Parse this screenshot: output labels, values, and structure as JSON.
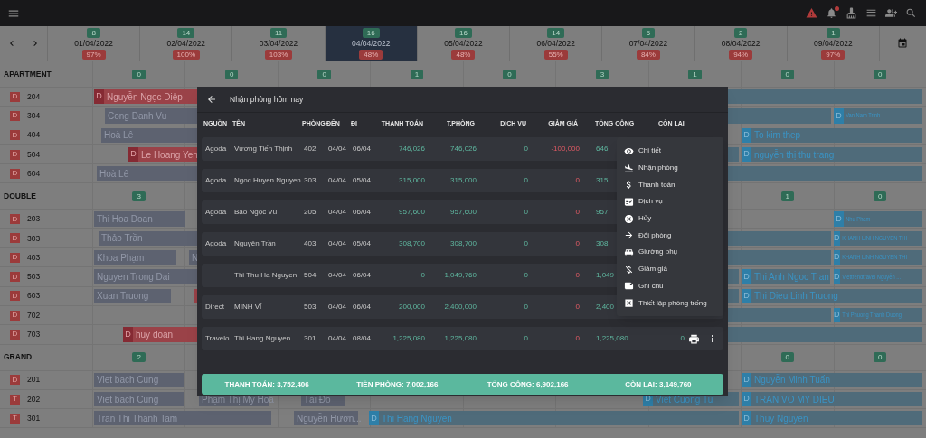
{
  "top_bar": {
    "notification_dot": true
  },
  "dates": [
    {
      "count": "8",
      "date": "01/04/2022",
      "occupancy": "97%",
      "selected": false
    },
    {
      "count": "14",
      "date": "02/04/2022",
      "occupancy": "100%",
      "selected": false
    },
    {
      "count": "11",
      "date": "03/04/2022",
      "occupancy": "103%",
      "selected": false
    },
    {
      "count": "16",
      "date": "04/04/2022",
      "occupancy": "48%",
      "selected": true
    },
    {
      "count": "16",
      "date": "05/04/2022",
      "occupancy": "48%",
      "selected": false
    },
    {
      "count": "14",
      "date": "06/04/2022",
      "occupancy": "55%",
      "selected": false
    },
    {
      "count": "5",
      "date": "07/04/2022",
      "occupancy": "84%",
      "selected": false
    },
    {
      "count": "2",
      "date": "08/04/2022",
      "occupancy": "94%",
      "selected": false
    },
    {
      "count": "1",
      "date": "09/04/2022",
      "occupancy": "97%",
      "selected": false
    }
  ],
  "groups": [
    {
      "name": "APARTMENT",
      "counts": [
        "0",
        "0",
        "0",
        "1",
        "0",
        "3",
        "1",
        "0",
        "0"
      ],
      "rooms": [
        {
          "type": "D",
          "number": "204",
          "bookings": [
            {
              "kind": "red",
              "flag": "D",
              "name": "Nguyễn Ngọc Diệp"
            },
            {
              "kind": "blue"
            }
          ]
        },
        {
          "type": "D",
          "number": "304",
          "bookings": [
            {
              "kind": "gray",
              "name": "Cong Danh Vu"
            },
            {
              "kind": "blue"
            },
            {
              "kind": "blue",
              "flag": "D",
              "name": "Van Nam Trinh"
            }
          ]
        },
        {
          "type": "D",
          "number": "404",
          "bookings": [
            {
              "kind": "gray",
              "name": "Hoà Lê"
            },
            {
              "kind": "blue",
              "flag": "D",
              "name": "To kim thep"
            }
          ]
        },
        {
          "type": "D",
          "number": "504",
          "bookings": [
            {
              "kind": "red",
              "flag": "D",
              "name": "Le Hoang Yen"
            },
            {
              "kind": "blue"
            },
            {
              "kind": "blue",
              "flag": "D",
              "name": "nguyễn thị thu trang"
            }
          ]
        },
        {
          "type": "D",
          "number": "604",
          "bookings": [
            {
              "kind": "gray",
              "name": "Hoà Lê"
            },
            {
              "kind": "blue"
            }
          ]
        }
      ]
    },
    {
      "name": "DOUBLE",
      "counts": [
        "3",
        "1",
        "0"
      ],
      "rooms": [
        {
          "type": "D",
          "number": "203",
          "bookings": [
            {
              "kind": "gray",
              "name": "Thi Hoa Doan"
            },
            {
              "kind": "blue",
              "flag": "D",
              "name": "Nhu Pham"
            }
          ]
        },
        {
          "type": "D",
          "number": "303",
          "bookings": [
            {
              "kind": "gray",
              "name": "Thảo Trần"
            },
            {
              "kind": "blue"
            },
            {
              "kind": "blue",
              "flag": "D",
              "name": "KHANH LINH NGUYEN THI"
            }
          ]
        },
        {
          "type": "D",
          "number": "403",
          "bookings": [
            {
              "kind": "gray",
              "name": "Khoa Phạm"
            },
            {
              "kind": "gray",
              "name": "N"
            },
            {
              "kind": "blue"
            },
            {
              "kind": "blue",
              "flag": "D",
              "name": "KHANH LINH NGUYEN THI"
            }
          ]
        },
        {
          "type": "D",
          "number": "503",
          "bookings": [
            {
              "kind": "gray",
              "name": "Nguyen Trong Dai"
            },
            {
              "kind": "blue"
            },
            {
              "kind": "blue",
              "flag": "D",
              "name": "Thi Anh Ngoc Tran"
            },
            {
              "kind": "blue",
              "flag": "D",
              "name": "Viettrendtravel Nguyễn ..."
            }
          ]
        },
        {
          "type": "D",
          "number": "603",
          "bookings": [
            {
              "kind": "gray",
              "name": "Xuan Truong"
            },
            {
              "kind": "red"
            },
            {
              "kind": "blue"
            },
            {
              "kind": "blue",
              "flag": "D",
              "name": "Thi Dieu Linh Truong"
            }
          ]
        },
        {
          "type": "D",
          "number": "702",
          "bookings": [
            {
              "kind": "blue"
            },
            {
              "kind": "blue",
              "flag": "D",
              "name": "Thi Phuong Thanh Duong"
            }
          ]
        },
        {
          "type": "D",
          "number": "703",
          "bookings": [
            {
              "kind": "red",
              "flag": "D",
              "name": "huy doan"
            },
            {
              "kind": "blue"
            }
          ]
        }
      ]
    },
    {
      "name": "GRAND",
      "counts": [
        "2",
        "0",
        "0"
      ],
      "rooms": [
        {
          "type": "D",
          "number": "201",
          "bookings": [
            {
              "kind": "gray",
              "name": "Viet bach Cung"
            },
            {
              "kind": "blue",
              "flag": "D",
              "name": "Nguyễn Minh Tuấn"
            }
          ]
        },
        {
          "type": "T",
          "number": "202",
          "bookings": [
            {
              "kind": "gray",
              "name": "Viet bach Cung"
            },
            {
              "kind": "gray",
              "name": "Phạm Thị My Hoa"
            },
            {
              "kind": "gray",
              "name": "Tài Đỗ"
            },
            {
              "kind": "blue",
              "flag": "D",
              "name": "Viet Cuong Tu"
            },
            {
              "kind": "blue",
              "flag": "D",
              "name": "TRAN VO MY DIEU"
            }
          ]
        },
        {
          "type": "T",
          "number": "301",
          "bookings": [
            {
              "kind": "gray",
              "name": "Tran Thi Thanh Tam"
            },
            {
              "kind": "gray",
              "name": "Nguyễn Hươn..."
            },
            {
              "kind": "blue",
              "flag": "D",
              "name": "Thi Hang Nguyen"
            },
            {
              "kind": "blue",
              "flag": "D",
              "name": "Thuy Nguyen"
            }
          ]
        }
      ]
    }
  ],
  "dialog": {
    "title": "Nhận phòng hôm nay",
    "columns": [
      "NGUỒN",
      "TÊN",
      "PHÒNG",
      "ĐẾN",
      "ĐI",
      "THANH TOÁN",
      "T.PHÒNG",
      "DỊCH VỤ",
      "GIẢM GIÁ",
      "TỔNG CỘNG",
      "CÒN LẠI"
    ],
    "rows": [
      {
        "source": "Agoda",
        "name": "Vương Tiến Thịnh",
        "room": "402",
        "arrival": "04/04",
        "departure": "06/04",
        "paid": "746,026",
        "room_total": "746,026",
        "services": "0",
        "discount": "-100,000",
        "total": "646"
      },
      {
        "source": "Agoda",
        "name": "Ngoc Huyen Nguyen",
        "room": "303",
        "arrival": "04/04",
        "departure": "05/04",
        "paid": "315,000",
        "room_total": "315,000",
        "services": "0",
        "discount": "0",
        "total": "315"
      },
      {
        "source": "Agoda",
        "name": "Bảo Ngọc Vũ",
        "room": "205",
        "arrival": "04/04",
        "departure": "06/04",
        "paid": "957,600",
        "room_total": "957,600",
        "services": "0",
        "discount": "0",
        "total": "957"
      },
      {
        "source": "Agoda",
        "name": "Nguyên Trần",
        "room": "403",
        "arrival": "04/04",
        "departure": "05/04",
        "paid": "308,700",
        "room_total": "308,700",
        "services": "0",
        "discount": "0",
        "total": "308"
      },
      {
        "name": "Thi Thu Ha Nguyen",
        "room": "504",
        "arrival": "04/04",
        "departure": "06/04",
        "paid": "0",
        "room_total": "1,049,760",
        "services": "0",
        "discount": "0",
        "total": "1,049"
      },
      {
        "source": "Direct",
        "name": "MINH VĨ",
        "room": "503",
        "arrival": "04/04",
        "departure": "06/04",
        "paid": "200,000",
        "room_total": "2,400,000",
        "services": "0",
        "discount": "0",
        "total": "2,400"
      },
      {
        "source": "Travelo...",
        "name": "Thi Hang Nguyen",
        "room": "301",
        "arrival": "04/04",
        "departure": "08/04",
        "paid": "1,225,080",
        "room_total": "1,225,080",
        "services": "0",
        "discount": "0",
        "total": "1,225,080",
        "remaining": "0"
      }
    ],
    "menu": [
      "Chi tiết",
      "Nhận phòng",
      "Thanh toán",
      "Dịch vụ",
      "Hủy",
      "Đổi phòng",
      "Giường phụ",
      "Giảm giá",
      "Ghi chú",
      "Thiết lập phòng trống"
    ],
    "summary": [
      "THANH TOÁN: 3,752,406",
      "TIỀN PHÒNG: 7,002,166",
      "TỔNG CỘNG: 6,902,166",
      "CÒN LẠI: 3,149,760"
    ]
  }
}
